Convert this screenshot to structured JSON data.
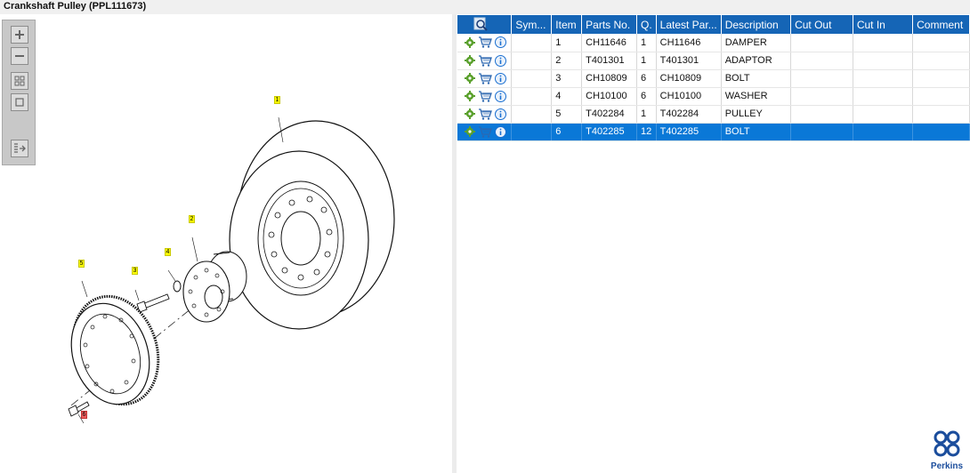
{
  "title": "Crankshaft Pulley (PPL111673)",
  "toolbar": {
    "zoom_in": "zoom-in-icon",
    "zoom_out": "zoom-out-icon",
    "fit": "fit-icon",
    "actual": "actual-size-icon",
    "export": "export-icon"
  },
  "callouts": [
    "1",
    "2",
    "3",
    "4",
    "5",
    "6"
  ],
  "table": {
    "columns": [
      "Sym...",
      "Item",
      "Parts No.",
      "Q.",
      "Latest Par...",
      "Description",
      "Cut Out",
      "Cut In",
      "Comment"
    ],
    "rows": [
      {
        "item": "1",
        "part": "CH11646",
        "qty": "1",
        "latest": "CH11646",
        "desc": "DAMPER",
        "sym": "",
        "cut_out": "",
        "cut_in": "",
        "comment": ""
      },
      {
        "item": "2",
        "part": "T401301",
        "qty": "1",
        "latest": "T401301",
        "desc": "ADAPTOR",
        "sym": "",
        "cut_out": "",
        "cut_in": "",
        "comment": ""
      },
      {
        "item": "3",
        "part": "CH10809",
        "qty": "6",
        "latest": "CH10809",
        "desc": "BOLT",
        "sym": "",
        "cut_out": "",
        "cut_in": "",
        "comment": ""
      },
      {
        "item": "4",
        "part": "CH10100",
        "qty": "6",
        "latest": "CH10100",
        "desc": "WASHER",
        "sym": "",
        "cut_out": "",
        "cut_in": "",
        "comment": ""
      },
      {
        "item": "5",
        "part": "T402284",
        "qty": "1",
        "latest": "T402284",
        "desc": "PULLEY",
        "sym": "",
        "cut_out": "",
        "cut_in": "",
        "comment": ""
      },
      {
        "item": "6",
        "part": "T402285",
        "qty": "12",
        "latest": "T402285",
        "desc": "BOLT",
        "sym": "",
        "cut_out": "",
        "cut_in": "",
        "comment": ""
      }
    ],
    "selected_row_index": 5
  },
  "logo": {
    "text": "Perkins"
  },
  "colors": {
    "header": "#1565b6",
    "selected": "#0a78d7",
    "callout": "#ffff00",
    "callout_highlight": "#f06060",
    "gear": "#5aa02c",
    "info": "#1a6fd1"
  }
}
